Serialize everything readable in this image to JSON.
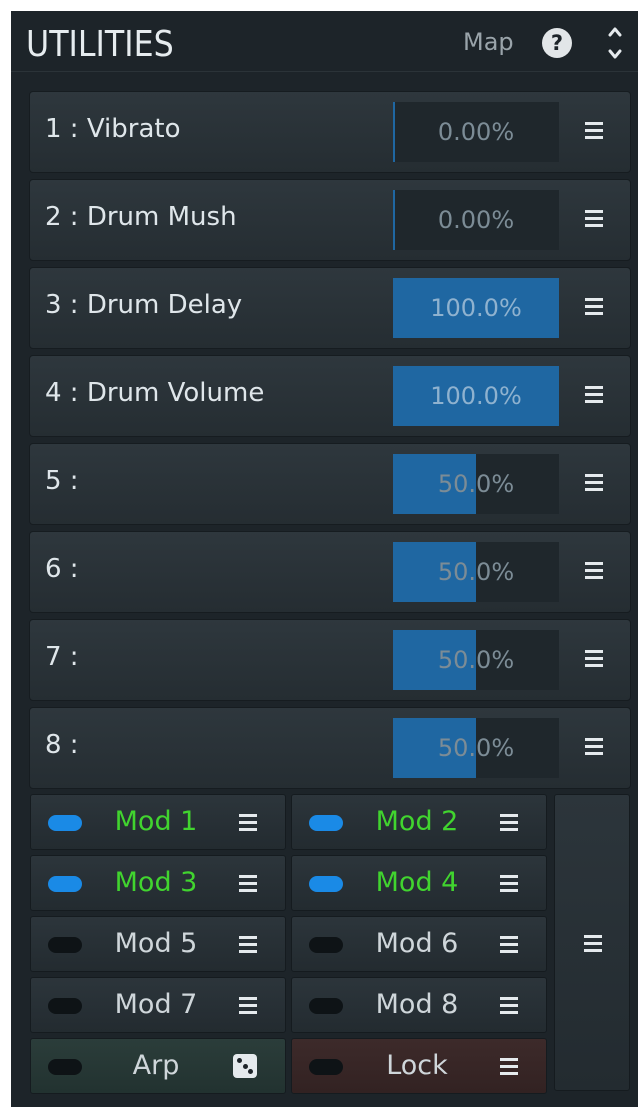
{
  "header": {
    "title": "UTILITIES",
    "map_label": "Map",
    "help_label": "?"
  },
  "params": [
    {
      "label": "1 : Vibrato",
      "value": "0.00%",
      "level": 0.0
    },
    {
      "label": "2 : Drum Mush",
      "value": "0.00%",
      "level": 0.0
    },
    {
      "label": "3 : Drum Delay",
      "value": "100.0%",
      "level": 1.0
    },
    {
      "label": "4 : Drum Volume",
      "value": "100.0%",
      "level": 1.0
    },
    {
      "label": "5 :",
      "value": "50.0%",
      "level": 0.5
    },
    {
      "label": "6 :",
      "value": "50.0%",
      "level": 0.5
    },
    {
      "label": "7 :",
      "value": "50.0%",
      "level": 0.5
    },
    {
      "label": "8 :",
      "value": "50.0%",
      "level": 0.5
    }
  ],
  "mods": [
    {
      "label": "Mod 1",
      "active": true
    },
    {
      "label": "Mod 2",
      "active": true
    },
    {
      "label": "Mod 3",
      "active": true
    },
    {
      "label": "Mod 4",
      "active": true
    },
    {
      "label": "Mod 5",
      "active": false
    },
    {
      "label": "Mod 6",
      "active": false
    },
    {
      "label": "Mod 7",
      "active": false
    },
    {
      "label": "Mod 8",
      "active": false
    }
  ],
  "arp": {
    "label": "Arp"
  },
  "lock": {
    "label": "Lock"
  },
  "colors": {
    "panel_bg": "#1d2429",
    "slider_fill": "#1f67a2",
    "led_on": "#1a8ae6",
    "mod_active_text": "#41d42f"
  }
}
